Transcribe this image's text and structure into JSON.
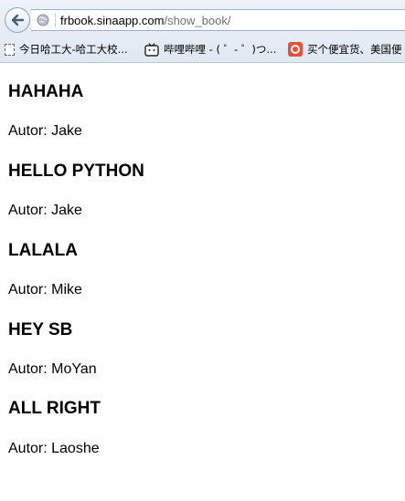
{
  "browser": {
    "url_domain": "frbook.sinaapp.com",
    "url_path": "/show_book/",
    "bookmarks": [
      {
        "label": "今日哈工大-哈工大校...",
        "icon": "page-icon"
      },
      {
        "label": "哔哩哔哩 - ( ゜- ゜)つ...",
        "icon": "bilibili-icon"
      },
      {
        "label": "买个便宜货、美国便",
        "icon": "shop-icon"
      }
    ]
  },
  "books": [
    {
      "title": "HAHAHA",
      "author_line": "Autor: Jake"
    },
    {
      "title": "HELLO PYTHON",
      "author_line": "Autor: Jake"
    },
    {
      "title": "LALALA",
      "author_line": "Autor: Mike"
    },
    {
      "title": "HEY SB",
      "author_line": "Autor: MoYan"
    },
    {
      "title": "ALL RIGHT",
      "author_line": "Autor: Laoshe"
    }
  ]
}
